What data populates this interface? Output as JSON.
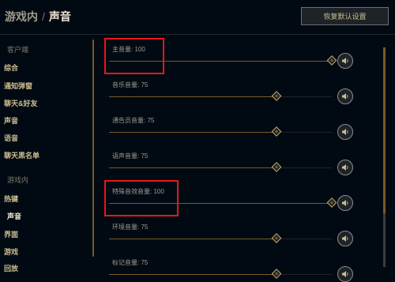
{
  "breadcrumb": {
    "parent": "游戏内",
    "separator": "/",
    "current": "声音"
  },
  "reset_button": "恢复默认设置",
  "sidebar": {
    "client_header": "客户端",
    "client_items": [
      "综合",
      "通知弹窗",
      "聊天&好友",
      "声音",
      "语音",
      "聊天黑名单"
    ],
    "ingame_header": "游戏内",
    "ingame_items": [
      "热键",
      "声音",
      "界面",
      "游戏",
      "回放"
    ],
    "active_item": "声音"
  },
  "volume_rows": [
    {
      "label": "主音量: 100",
      "value": 100,
      "highlighted": true
    },
    {
      "label": "音乐音量: 75",
      "value": 75,
      "highlighted": false
    },
    {
      "label": "通告员音量: 75",
      "value": 75,
      "highlighted": false
    },
    {
      "label": "语声音量: 75",
      "value": 75,
      "highlighted": false
    },
    {
      "label": "特殊音效音量: 100",
      "value": 100,
      "highlighted": true
    },
    {
      "label": "环境音量: 75",
      "value": 75,
      "highlighted": false
    },
    {
      "label": "标记音量: 75",
      "value": 75,
      "highlighted": false
    }
  ],
  "icons": {
    "speaker": "speaker-icon"
  },
  "colors": {
    "background": "#010a13",
    "gold": "#c8aa6e",
    "highlight": "#e8161b"
  }
}
